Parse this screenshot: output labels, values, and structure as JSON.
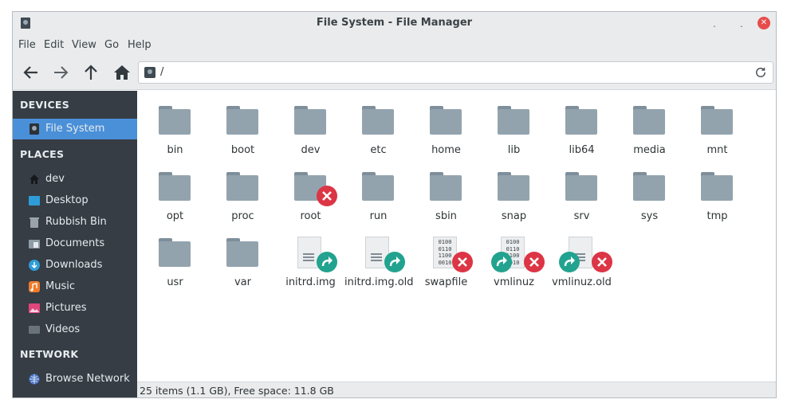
{
  "window": {
    "title": "File System - File Manager",
    "controls": {
      "minimize": "˯",
      "maximize": "˰",
      "close": "✕"
    }
  },
  "menubar": {
    "items": [
      "File",
      "Edit",
      "View",
      "Go",
      "Help"
    ]
  },
  "toolbar": {
    "buttons": [
      "back-arrow-icon",
      "forward-arrow-icon",
      "up-arrow-icon",
      "home-icon"
    ],
    "location_path": "/"
  },
  "sidebar": {
    "sections": [
      {
        "header": "DEVICES",
        "items": [
          {
            "label": "File System",
            "icon": "drive-icon",
            "active": true
          }
        ]
      },
      {
        "header": "PLACES",
        "items": [
          {
            "label": "dev",
            "icon": "home-icon"
          },
          {
            "label": "Desktop",
            "icon": "desktop-icon"
          },
          {
            "label": "Rubbish Bin",
            "icon": "trash-icon"
          },
          {
            "label": "Documents",
            "icon": "documents-folder-icon"
          },
          {
            "label": "Downloads",
            "icon": "downloads-icon"
          },
          {
            "label": "Music",
            "icon": "music-icon"
          },
          {
            "label": "Pictures",
            "icon": "pictures-icon"
          },
          {
            "label": "Videos",
            "icon": "videos-icon"
          }
        ]
      },
      {
        "header": "NETWORK",
        "items": [
          {
            "label": "Browse Network",
            "icon": "network-icon"
          }
        ]
      }
    ]
  },
  "files": [
    {
      "name": "bin",
      "type": "folder"
    },
    {
      "name": "boot",
      "type": "folder"
    },
    {
      "name": "dev",
      "type": "folder"
    },
    {
      "name": "etc",
      "type": "folder"
    },
    {
      "name": "home",
      "type": "folder"
    },
    {
      "name": "lib",
      "type": "folder"
    },
    {
      "name": "lib64",
      "type": "folder"
    },
    {
      "name": "media",
      "type": "folder"
    },
    {
      "name": "mnt",
      "type": "folder"
    },
    {
      "name": "opt",
      "type": "folder"
    },
    {
      "name": "proc",
      "type": "folder"
    },
    {
      "name": "root",
      "type": "folder",
      "emblems": [
        "error"
      ]
    },
    {
      "name": "run",
      "type": "folder"
    },
    {
      "name": "sbin",
      "type": "folder"
    },
    {
      "name": "snap",
      "type": "folder"
    },
    {
      "name": "srv",
      "type": "folder"
    },
    {
      "name": "sys",
      "type": "folder"
    },
    {
      "name": "tmp",
      "type": "folder"
    },
    {
      "name": "usr",
      "type": "folder"
    },
    {
      "name": "var",
      "type": "folder"
    },
    {
      "name": "initrd.img",
      "type": "document",
      "emblems": [
        "link"
      ]
    },
    {
      "name": "initrd.img.old",
      "type": "document",
      "emblems": [
        "link"
      ]
    },
    {
      "name": "swapfile",
      "type": "binary",
      "binary_text": "0100\n0110\n1100\n0010",
      "emblems": [
        "error"
      ]
    },
    {
      "name": "vmlinuz",
      "type": "binary",
      "binary_text": "0100\n0110\n1100\n0010",
      "emblems": [
        "link",
        "error"
      ]
    },
    {
      "name": "vmlinuz.old",
      "type": "document",
      "emblems": [
        "link",
        "error"
      ]
    }
  ],
  "statusbar": {
    "text": "25 items (1.1 GB), Free space: 11.8 GB"
  },
  "colors": {
    "sidebar_bg": "#363d45",
    "selection": "#4a90d9",
    "folder": "#93a3ae",
    "error_emblem": "#dc3545",
    "link_emblem": "#22a38f"
  }
}
